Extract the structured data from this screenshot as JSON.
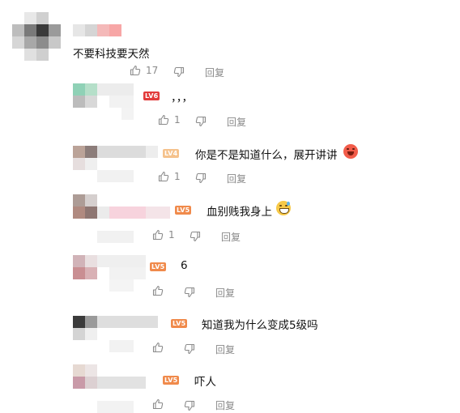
{
  "colors": {
    "action_gray": "#8a8a8a",
    "level6": "#e23b3b",
    "level5": "#f08a4b",
    "level4": "#f5c28c"
  },
  "comments": [
    {
      "text": "不要科技要天然",
      "likes": "17",
      "reply_label": "回复"
    },
    {
      "text": "，，，",
      "level": "LV6",
      "likes": "1",
      "reply_label": "回复"
    },
    {
      "text": "你是不是知道什么，展开讲讲",
      "level": "LV4",
      "emoji": "laughing-face-emoji",
      "likes": "1",
      "reply_label": "回复"
    },
    {
      "text": "血别贱我身上",
      "level": "LV5",
      "emoji": "grinning-sweat-emoji",
      "likes": "1",
      "reply_label": "回复"
    },
    {
      "text": "6",
      "level": "LV5",
      "likes": "",
      "reply_label": "回复"
    },
    {
      "text": "知道我为什么变成5级吗",
      "level": "LV5",
      "likes": "",
      "reply_label": "回复"
    },
    {
      "text": "吓人",
      "level": "LV5",
      "likes": "",
      "reply_label": "回复"
    }
  ]
}
